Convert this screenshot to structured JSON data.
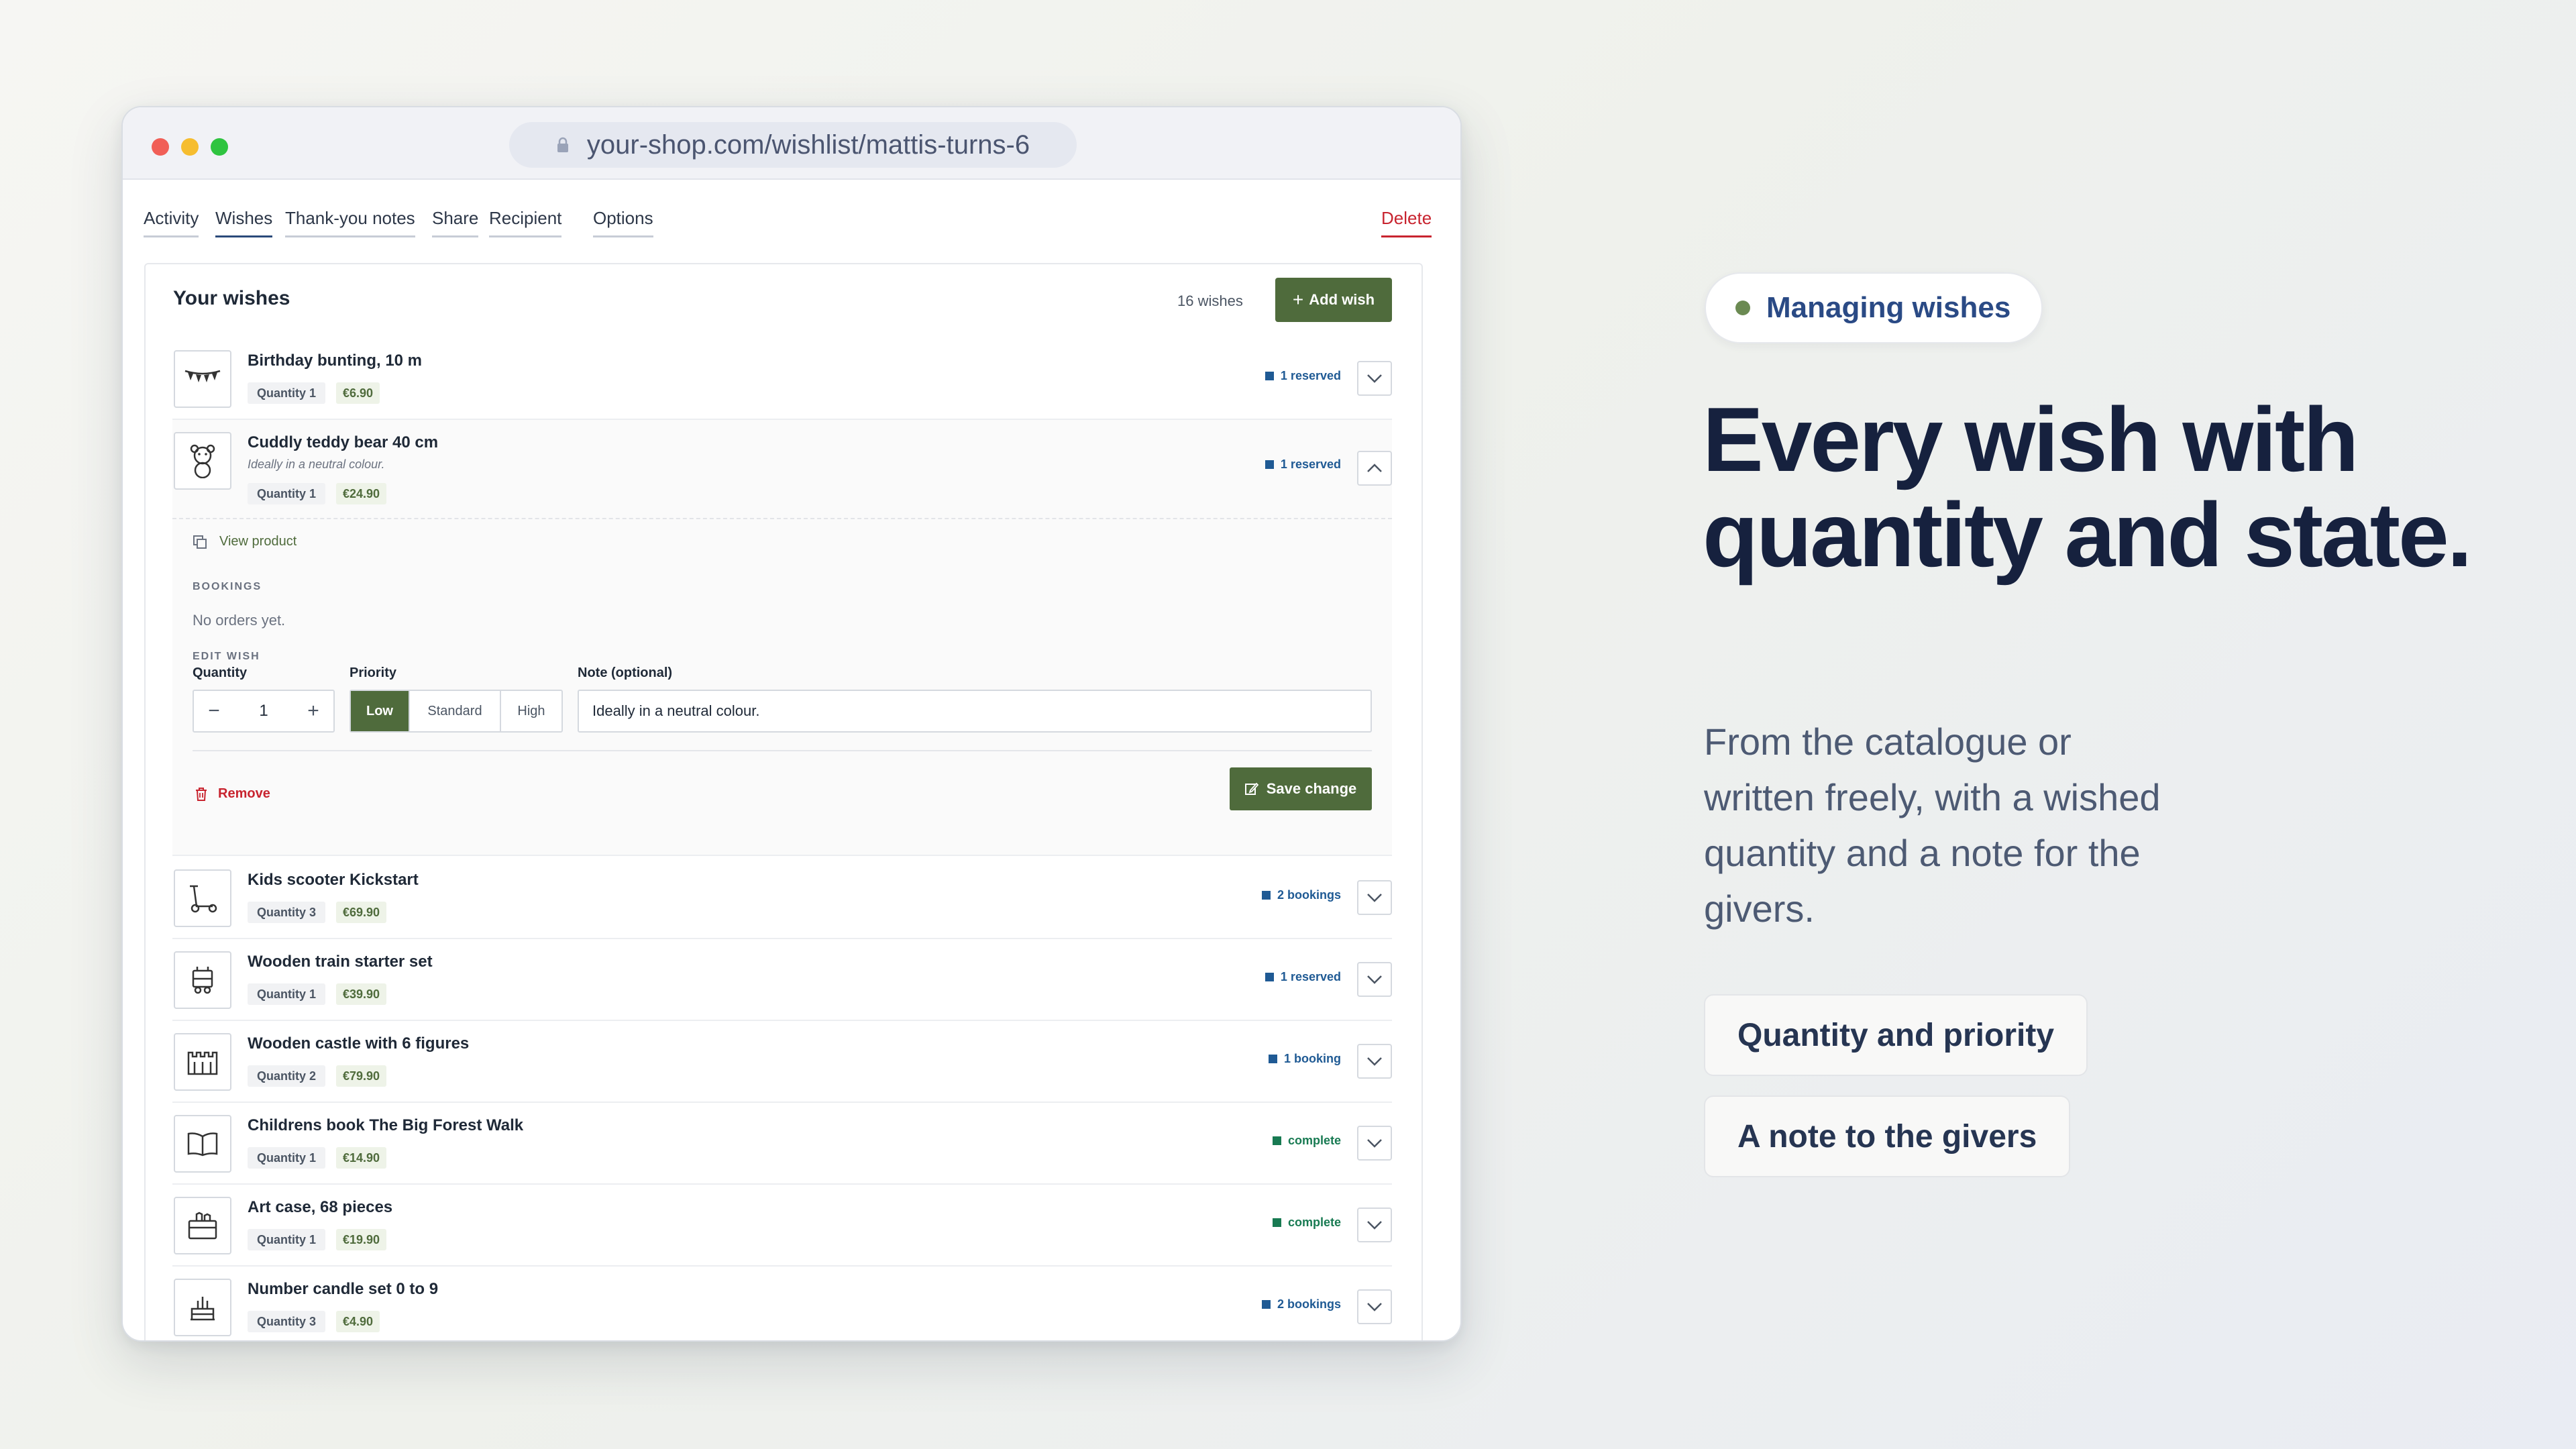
{
  "browser": {
    "url": "your-shop.com/wishlist/mattis-turns-6"
  },
  "tabs": [
    {
      "label": "Activity"
    },
    {
      "label": "Wishes"
    },
    {
      "label": "Thank-you notes"
    },
    {
      "label": "Share"
    },
    {
      "label": "Recipient"
    },
    {
      "label": "Options"
    }
  ],
  "delete_label": "Delete",
  "panel": {
    "title": "Your wishes",
    "count": "16 wishes",
    "add_label": "Add wish"
  },
  "wishes": [
    {
      "name": "Birthday bunting, 10 m",
      "quantity": "Quantity 1",
      "price": "€6.90",
      "status": "1 reserved",
      "icon": "bunting-icon"
    },
    {
      "name": "Cuddly teddy bear 40 cm",
      "note": "Ideally in a neutral colour.",
      "quantity": "Quantity 1",
      "price": "€24.90",
      "status": "1 reserved",
      "icon": "teddy-bear-icon"
    },
    {
      "name": "Kids scooter Kickstart",
      "quantity": "Quantity 3",
      "price": "€69.90",
      "status": "2 bookings",
      "icon": "scooter-icon"
    },
    {
      "name": "Wooden train starter set",
      "quantity": "Quantity 1",
      "price": "€39.90",
      "status": "1 reserved",
      "icon": "train-icon"
    },
    {
      "name": "Wooden castle with 6 figures",
      "quantity": "Quantity 2",
      "price": "€79.90",
      "status": "1 booking",
      "icon": "castle-icon"
    },
    {
      "name": "Childrens book The Big Forest Walk",
      "quantity": "Quantity 1",
      "price": "€14.90",
      "status": "complete",
      "icon": "book-icon"
    },
    {
      "name": "Art case, 68 pieces",
      "quantity": "Quantity 1",
      "price": "€19.90",
      "status": "complete",
      "icon": "art-case-icon"
    },
    {
      "name": "Number candle set 0 to 9",
      "quantity": "Quantity 3",
      "price": "€4.90",
      "status": "2 bookings",
      "icon": "cake-candle-icon"
    }
  ],
  "detail": {
    "view_product": "View product",
    "bookings_label": "BOOKINGS",
    "no_orders": "No orders yet.",
    "edit_label": "EDIT WISH",
    "quantity_label": "Quantity",
    "quantity_value": "1",
    "priority_label": "Priority",
    "priority_options": [
      "Low",
      "Standard",
      "High"
    ],
    "priority_selected": "Low",
    "note_label": "Note (optional)",
    "note_value": "Ideally in a neutral colour.",
    "remove_label": "Remove",
    "save_label": "Save change"
  },
  "promo": {
    "pill": "Managing wishes",
    "headline": "Every wish with quantity and state.",
    "subtext": "From the catalogue or written freely, with a wished quantity and a note for the givers.",
    "features": [
      "Quantity and priority",
      "A note to the givers"
    ]
  },
  "colors": {
    "accent_green": "#4f6b3c",
    "status_blue": "#1f5a94",
    "status_green": "#187a52",
    "danger": "#c8242f",
    "headline": "#16213e",
    "pill_text": "#2a4a85"
  }
}
